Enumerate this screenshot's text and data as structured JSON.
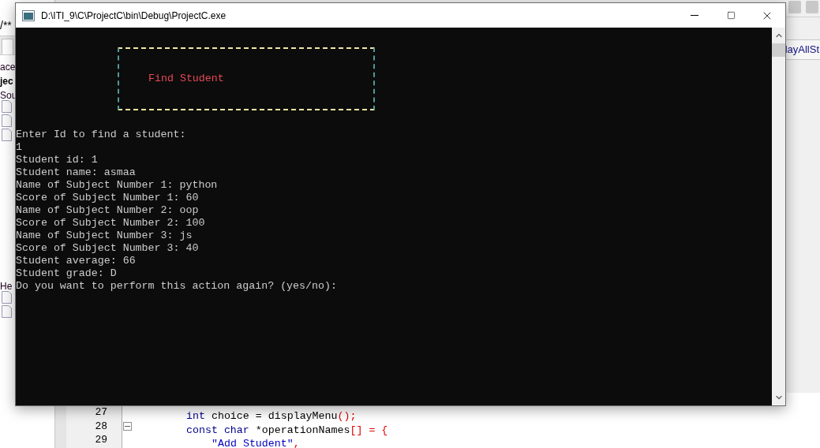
{
  "ide": {
    "breadcrumb": "/**",
    "explorer": [
      {
        "kind": "label",
        "text": "ace"
      },
      {
        "kind": "heading",
        "text": "jec"
      },
      {
        "kind": "label",
        "text": "Sou"
      },
      {
        "kind": "file"
      },
      {
        "kind": "file"
      },
      {
        "kind": "file"
      },
      {
        "kind": "gap"
      },
      {
        "kind": "label",
        "text": "He"
      },
      {
        "kind": "file"
      },
      {
        "kind": "file"
      }
    ],
    "function_tab": "layAllSt",
    "code_lines": [
      {
        "number": "27",
        "fold": false,
        "tokens": [
          {
            "kind": "keyword",
            "text": "int"
          },
          {
            "kind": "plain",
            "text": " choice = displayMenu"
          },
          {
            "kind": "punct",
            "text": "();"
          }
        ]
      },
      {
        "number": "28",
        "fold": true,
        "tokens": [
          {
            "kind": "keyword",
            "text": "const char"
          },
          {
            "kind": "plain",
            "text": " *operationNames"
          },
          {
            "kind": "punct",
            "text": "[] = {"
          }
        ],
        "children": [
          {
            "number": "29",
            "fold": false,
            "tokens": [
              {
                "kind": "string",
                "text": "\"Add Student\""
              },
              {
                "kind": "punct",
                "text": ","
              }
            ]
          }
        ]
      }
    ]
  },
  "window": {
    "title": "D:\\ITI_9\\C\\ProjectC\\bin\\Debug\\ProjectC.exe"
  },
  "console": {
    "banner": "Find Student",
    "lines": [
      "Enter Id to find a student:",
      "1",
      "Student id: 1",
      "Student name: asmaa",
      "Name of Subject Number 1: python",
      "Score of Subject Number 1: 60",
      "Name of Subject Number 2: oop",
      "Score of Subject Number 2: 100",
      "Name of Subject Number 3: js",
      "Score of Subject Number 3: 40",
      "Student average: 66",
      "Student grade: D",
      "Do you want to perform this action again? (yes/no):"
    ]
  }
}
